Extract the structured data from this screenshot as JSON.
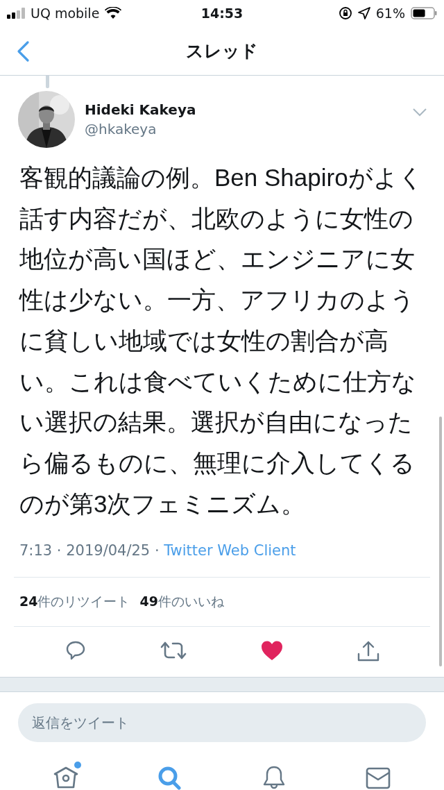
{
  "status_bar": {
    "carrier": "UQ mobile",
    "time": "14:53",
    "battery": "61%"
  },
  "nav": {
    "title": "スレッド"
  },
  "tweet": {
    "name": "Hideki Kakeya",
    "handle": "@hkakeya",
    "text": "客観的議論の例。Ben Shapiroがよく話す内容だが、北欧のように女性の地位が高い国ほど、エンジニアに女性は少ない。一方、アフリカのように貧しい地域では女性の割合が高い。これは食べていくために仕方ない選択の結果。選択が自由になったら偏るものに、無理に介入してくるのが第3次フェミニズム。",
    "time": "7:13 · 2019/04/25 · ",
    "client": "Twitter Web Client",
    "stats": [
      {
        "count": "24",
        "label": "件のリツイート"
      },
      {
        "count": "49",
        "label": "件のいいね"
      }
    ],
    "actions": [
      {
        "kind": "reply",
        "on": false
      },
      {
        "kind": "retweet",
        "on": false
      },
      {
        "kind": "like",
        "on": true
      },
      {
        "kind": "share",
        "on": false
      }
    ]
  },
  "reply_field": {
    "placeholder": "返信をツイート"
  },
  "tab_bar": [
    {
      "kind": "home",
      "selected": false,
      "badge": true
    },
    {
      "kind": "search",
      "selected": true,
      "badge": false
    },
    {
      "kind": "notifications",
      "selected": false,
      "badge": false
    },
    {
      "kind": "messages",
      "selected": false,
      "badge": false
    }
  ]
}
